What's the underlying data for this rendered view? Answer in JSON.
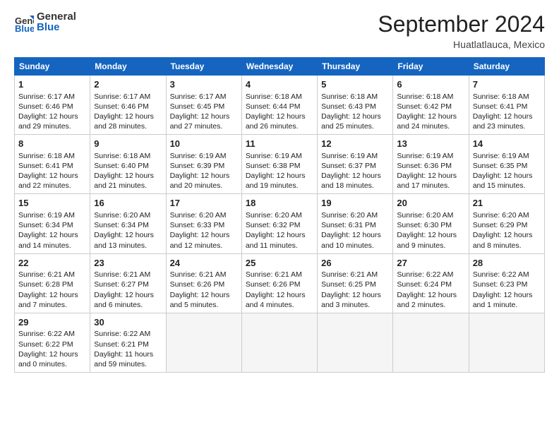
{
  "header": {
    "logo_line1": "General",
    "logo_line2": "Blue",
    "month_year": "September 2024",
    "location": "Huatlatlauca, Mexico"
  },
  "days_of_week": [
    "Sunday",
    "Monday",
    "Tuesday",
    "Wednesday",
    "Thursday",
    "Friday",
    "Saturday"
  ],
  "weeks": [
    [
      {
        "day": "1",
        "lines": [
          "Sunrise: 6:17 AM",
          "Sunset: 6:46 PM",
          "Daylight: 12 hours",
          "and 29 minutes."
        ]
      },
      {
        "day": "2",
        "lines": [
          "Sunrise: 6:17 AM",
          "Sunset: 6:46 PM",
          "Daylight: 12 hours",
          "and 28 minutes."
        ]
      },
      {
        "day": "3",
        "lines": [
          "Sunrise: 6:17 AM",
          "Sunset: 6:45 PM",
          "Daylight: 12 hours",
          "and 27 minutes."
        ]
      },
      {
        "day": "4",
        "lines": [
          "Sunrise: 6:18 AM",
          "Sunset: 6:44 PM",
          "Daylight: 12 hours",
          "and 26 minutes."
        ]
      },
      {
        "day": "5",
        "lines": [
          "Sunrise: 6:18 AM",
          "Sunset: 6:43 PM",
          "Daylight: 12 hours",
          "and 25 minutes."
        ]
      },
      {
        "day": "6",
        "lines": [
          "Sunrise: 6:18 AM",
          "Sunset: 6:42 PM",
          "Daylight: 12 hours",
          "and 24 minutes."
        ]
      },
      {
        "day": "7",
        "lines": [
          "Sunrise: 6:18 AM",
          "Sunset: 6:41 PM",
          "Daylight: 12 hours",
          "and 23 minutes."
        ]
      }
    ],
    [
      {
        "day": "8",
        "lines": [
          "Sunrise: 6:18 AM",
          "Sunset: 6:41 PM",
          "Daylight: 12 hours",
          "and 22 minutes."
        ]
      },
      {
        "day": "9",
        "lines": [
          "Sunrise: 6:18 AM",
          "Sunset: 6:40 PM",
          "Daylight: 12 hours",
          "and 21 minutes."
        ]
      },
      {
        "day": "10",
        "lines": [
          "Sunrise: 6:19 AM",
          "Sunset: 6:39 PM",
          "Daylight: 12 hours",
          "and 20 minutes."
        ]
      },
      {
        "day": "11",
        "lines": [
          "Sunrise: 6:19 AM",
          "Sunset: 6:38 PM",
          "Daylight: 12 hours",
          "and 19 minutes."
        ]
      },
      {
        "day": "12",
        "lines": [
          "Sunrise: 6:19 AM",
          "Sunset: 6:37 PM",
          "Daylight: 12 hours",
          "and 18 minutes."
        ]
      },
      {
        "day": "13",
        "lines": [
          "Sunrise: 6:19 AM",
          "Sunset: 6:36 PM",
          "Daylight: 12 hours",
          "and 17 minutes."
        ]
      },
      {
        "day": "14",
        "lines": [
          "Sunrise: 6:19 AM",
          "Sunset: 6:35 PM",
          "Daylight: 12 hours",
          "and 15 minutes."
        ]
      }
    ],
    [
      {
        "day": "15",
        "lines": [
          "Sunrise: 6:19 AM",
          "Sunset: 6:34 PM",
          "Daylight: 12 hours",
          "and 14 minutes."
        ]
      },
      {
        "day": "16",
        "lines": [
          "Sunrise: 6:20 AM",
          "Sunset: 6:34 PM",
          "Daylight: 12 hours",
          "and 13 minutes."
        ]
      },
      {
        "day": "17",
        "lines": [
          "Sunrise: 6:20 AM",
          "Sunset: 6:33 PM",
          "Daylight: 12 hours",
          "and 12 minutes."
        ]
      },
      {
        "day": "18",
        "lines": [
          "Sunrise: 6:20 AM",
          "Sunset: 6:32 PM",
          "Daylight: 12 hours",
          "and 11 minutes."
        ]
      },
      {
        "day": "19",
        "lines": [
          "Sunrise: 6:20 AM",
          "Sunset: 6:31 PM",
          "Daylight: 12 hours",
          "and 10 minutes."
        ]
      },
      {
        "day": "20",
        "lines": [
          "Sunrise: 6:20 AM",
          "Sunset: 6:30 PM",
          "Daylight: 12 hours",
          "and 9 minutes."
        ]
      },
      {
        "day": "21",
        "lines": [
          "Sunrise: 6:20 AM",
          "Sunset: 6:29 PM",
          "Daylight: 12 hours",
          "and 8 minutes."
        ]
      }
    ],
    [
      {
        "day": "22",
        "lines": [
          "Sunrise: 6:21 AM",
          "Sunset: 6:28 PM",
          "Daylight: 12 hours",
          "and 7 minutes."
        ]
      },
      {
        "day": "23",
        "lines": [
          "Sunrise: 6:21 AM",
          "Sunset: 6:27 PM",
          "Daylight: 12 hours",
          "and 6 minutes."
        ]
      },
      {
        "day": "24",
        "lines": [
          "Sunrise: 6:21 AM",
          "Sunset: 6:26 PM",
          "Daylight: 12 hours",
          "and 5 minutes."
        ]
      },
      {
        "day": "25",
        "lines": [
          "Sunrise: 6:21 AM",
          "Sunset: 6:26 PM",
          "Daylight: 12 hours",
          "and 4 minutes."
        ]
      },
      {
        "day": "26",
        "lines": [
          "Sunrise: 6:21 AM",
          "Sunset: 6:25 PM",
          "Daylight: 12 hours",
          "and 3 minutes."
        ]
      },
      {
        "day": "27",
        "lines": [
          "Sunrise: 6:22 AM",
          "Sunset: 6:24 PM",
          "Daylight: 12 hours",
          "and 2 minutes."
        ]
      },
      {
        "day": "28",
        "lines": [
          "Sunrise: 6:22 AM",
          "Sunset: 6:23 PM",
          "Daylight: 12 hours",
          "and 1 minute."
        ]
      }
    ],
    [
      {
        "day": "29",
        "lines": [
          "Sunrise: 6:22 AM",
          "Sunset: 6:22 PM",
          "Daylight: 12 hours",
          "and 0 minutes."
        ]
      },
      {
        "day": "30",
        "lines": [
          "Sunrise: 6:22 AM",
          "Sunset: 6:21 PM",
          "Daylight: 11 hours",
          "and 59 minutes."
        ]
      },
      {
        "day": "",
        "lines": []
      },
      {
        "day": "",
        "lines": []
      },
      {
        "day": "",
        "lines": []
      },
      {
        "day": "",
        "lines": []
      },
      {
        "day": "",
        "lines": []
      }
    ]
  ]
}
